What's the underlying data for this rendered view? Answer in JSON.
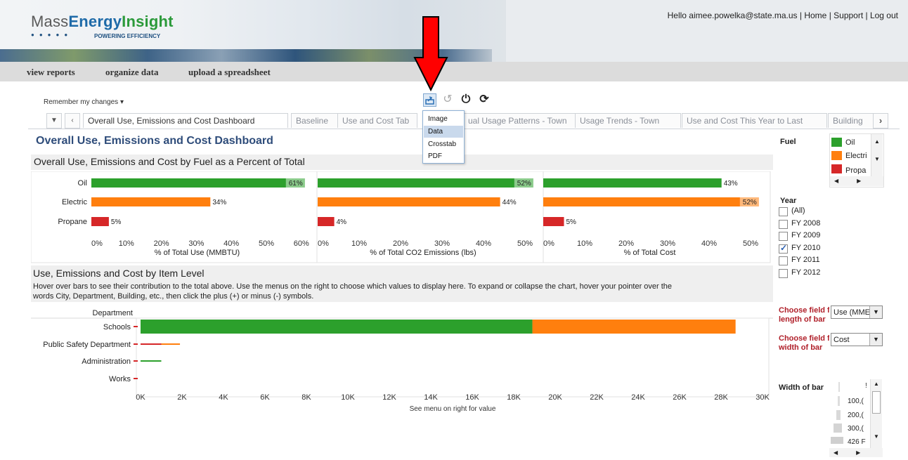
{
  "header": {
    "logo": {
      "part1": "Mass",
      "part2": "Energy",
      "part3": "Insight",
      "tagline": "POWERING EFFICIENCY"
    },
    "user_links": "Hello aimee.powelka@state.ma.us | Home | Support | Log out"
  },
  "nav": {
    "items": [
      "view reports",
      "organize data",
      "upload a spreadsheet"
    ]
  },
  "toolbar": {
    "remember_label": "Remember my changes",
    "icons": [
      "export-icon",
      "revert-icon",
      "power-icon",
      "refresh-icon"
    ]
  },
  "export_menu": {
    "items": [
      "Image",
      "Data",
      "Crosstab",
      "PDF"
    ],
    "highlighted": "Data"
  },
  "tabs": {
    "items": [
      "Overall Use, Emissions and Cost Dashboard",
      "Baseline",
      "Use and Cost Tab",
      "ual Usage Patterns - Town",
      "Usage Trends - Town",
      "Use and Cost This Year to Last",
      "Building"
    ],
    "active": "Overall Use, Emissions and Cost Dashboard"
  },
  "dashboard": {
    "title": "Overall Use, Emissions and Cost Dashboard",
    "section1_title": "Overall Use, Emissions and Cost by Fuel as a Percent of Total",
    "section2_title": "Use, Emissions and Cost by Item Level",
    "section2_desc1": "Hover over bars to see their contribution to the total above. Use the menus on the right to choose which values to display here. To expand or collapse the chart, hover your pointer over the",
    "section2_desc2": "words City, Department, Building, etc., then click the plus (+) or minus (-) symbols."
  },
  "colors": {
    "oil": "#2ca02c",
    "electric": "#ff7f0e",
    "propane": "#d62728"
  },
  "chart_data": [
    {
      "type": "bar",
      "orientation": "horizontal",
      "categories": [
        "Oil",
        "Electric",
        "Propane"
      ],
      "values": [
        61,
        34,
        5
      ],
      "data_labels": [
        "61%",
        "34%",
        "5%"
      ],
      "xlabel": "% of Total Use (MMBTU)",
      "xticks": [
        "0%",
        "10%",
        "20%",
        "30%",
        "40%",
        "50%",
        "60%"
      ],
      "xlim": [
        0,
        60
      ]
    },
    {
      "type": "bar",
      "orientation": "horizontal",
      "categories": [
        "Oil",
        "Electric",
        "Propane"
      ],
      "values": [
        52,
        44,
        4
      ],
      "data_labels": [
        "52%",
        "44%",
        "4%"
      ],
      "xlabel": "% of Total CO2 Emissions (lbs)",
      "xticks": [
        "0%",
        "10%",
        "20%",
        "30%",
        "40%",
        "50%"
      ],
      "xlim": [
        0,
        50
      ]
    },
    {
      "type": "bar",
      "orientation": "horizontal",
      "categories": [
        "Oil",
        "Electric",
        "Propane"
      ],
      "values": [
        43,
        52,
        5
      ],
      "data_labels": [
        "43%",
        "52%",
        "5%"
      ],
      "xlabel": "% of Total Cost",
      "xticks": [
        "0%",
        "10%",
        "20%",
        "30%",
        "40%",
        "50%"
      ],
      "xlim": [
        0,
        50
      ]
    },
    {
      "type": "bar",
      "orientation": "horizontal",
      "stacked": true,
      "row_header": "Department",
      "categories": [
        "Schools",
        "Public Safety Department",
        "Administration",
        "Works"
      ],
      "series": [
        {
          "name": "Propane",
          "values": [
            0,
            1000,
            0,
            0
          ]
        },
        {
          "name": "Oil",
          "values": [
            18900,
            0,
            1000,
            0
          ]
        },
        {
          "name": "Electric",
          "values": [
            9800,
            900,
            0,
            0
          ]
        }
      ],
      "xlabel": "See menu on right for value",
      "xticks": [
        "0K",
        "2K",
        "4K",
        "6K",
        "8K",
        "10K",
        "12K",
        "14K",
        "16K",
        "18K",
        "20K",
        "22K",
        "24K",
        "26K",
        "28K",
        "30K"
      ],
      "xlim": [
        0,
        30000
      ]
    }
  ],
  "right_panel": {
    "fuel_label": "Fuel",
    "fuel_items": [
      "Oil",
      "Electri",
      "Propa"
    ],
    "year_label": "Year",
    "year_items": [
      {
        "label": "(All)",
        "checked": false
      },
      {
        "label": "FY 2008",
        "checked": false
      },
      {
        "label": "FY 2009",
        "checked": false
      },
      {
        "label": "FY 2010",
        "checked": true
      },
      {
        "label": "FY 2011",
        "checked": false
      },
      {
        "label": "FY 2012",
        "checked": false
      }
    ],
    "length_label_1": "Choose field f",
    "length_label_2": "length of bar",
    "length_value": "Use (MME",
    "width_label_1": "Choose field f",
    "width_label_2": "width of bar",
    "width_value": "Cost",
    "width_of_bar_label": "Width of bar",
    "width_items": [
      "100,(",
      "200,(",
      "300,(",
      "426 F"
    ],
    "width_top_item": "!"
  }
}
